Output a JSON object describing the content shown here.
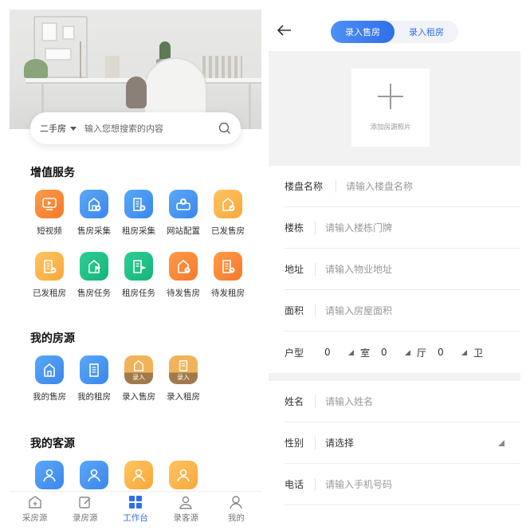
{
  "left": {
    "search": {
      "type": "二手房",
      "placeholder": "输入您想搜索的内容"
    },
    "sections": {
      "value_services": {
        "title": "增值服务",
        "items": [
          {
            "label": "短视频",
            "color": "#f57a2a",
            "icon": "video-icon"
          },
          {
            "label": "售房采集",
            "color": "#3b86ec",
            "icon": "house-add-icon"
          },
          {
            "label": "租房采集",
            "color": "#3b86ec",
            "icon": "building-add-icon"
          },
          {
            "label": "网站配置",
            "color": "#3b86ec",
            "icon": "gear-icon"
          },
          {
            "label": "已发售房",
            "color": "#f7a83a",
            "icon": "house-check-icon"
          },
          {
            "label": "已发租房",
            "color": "#f7a83a",
            "icon": "building-check-icon"
          },
          {
            "label": "售房任务",
            "color": "#15b57a",
            "icon": "house-flag-icon"
          },
          {
            "label": "租房任务",
            "color": "#15b57a",
            "icon": "building-flag-icon"
          },
          {
            "label": "待发售房",
            "color": "#f57a2a",
            "icon": "house-clock-icon"
          },
          {
            "label": "待发租房",
            "color": "#f57a2a",
            "icon": "building-clock-icon"
          }
        ]
      },
      "my_listings": {
        "title": "我的房源",
        "items": [
          {
            "label": "我的售房",
            "color": "#3b86ec",
            "icon": "house-icon"
          },
          {
            "label": "我的租房",
            "color": "#3b86ec",
            "icon": "building-icon"
          },
          {
            "label": "录入售房",
            "ribbon": "录入",
            "icon": "house-entry-icon"
          },
          {
            "label": "录入租房",
            "ribbon": "录入",
            "icon": "building-entry-icon"
          }
        ]
      },
      "my_clients": {
        "title": "我的客源"
      }
    },
    "tabbar": [
      {
        "label": "采房源",
        "icon": "house-plus-icon",
        "active": false
      },
      {
        "label": "录房源",
        "icon": "edit-icon",
        "active": false
      },
      {
        "label": "工作台",
        "icon": "grid-icon",
        "active": true
      },
      {
        "label": "录客源",
        "icon": "user-add-icon",
        "active": false
      },
      {
        "label": "我的",
        "icon": "person-icon",
        "active": false
      }
    ]
  },
  "right": {
    "segments": {
      "sale": "录入售房",
      "rent": "录入租房"
    },
    "photo": {
      "label": "添加房源照片"
    },
    "form": {
      "estate": {
        "label": "楼盘名称",
        "placeholder": "请输入楼盘名称"
      },
      "building": {
        "label": "楼栋",
        "placeholder": "请输入楼栋门牌"
      },
      "address": {
        "label": "地址",
        "placeholder": "请输入物业地址"
      },
      "area": {
        "label": "面积",
        "placeholder": "请输入房屋面积"
      },
      "layout": {
        "label": "户型",
        "rooms": {
          "value": "0",
          "unit": "室"
        },
        "halls": {
          "value": "0",
          "unit": "厅"
        },
        "baths": {
          "value": "0",
          "unit": "卫"
        }
      },
      "name": {
        "label": "姓名",
        "placeholder": "请输入姓名"
      },
      "gender": {
        "label": "性别",
        "value": "请选择"
      },
      "phone": {
        "label": "电话",
        "placeholder": "请输入手机号码"
      }
    },
    "accent": "#2f6fea"
  }
}
